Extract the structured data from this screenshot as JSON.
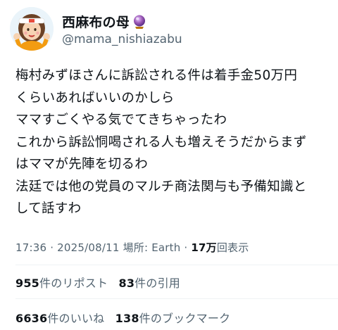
{
  "user": {
    "display_name": "西麻布の母",
    "handle": "@mama_nishiazabu",
    "badge_icon": "crystal-ball-icon",
    "avatar_icon": "avatar-illustration"
  },
  "tweet": {
    "lines": [
      "梅村みずほさんに訴訟される件は着手金50万円",
      "くらいあればいいのかしら",
      "ママすごくやる気でてきちゃったわ",
      "これから訴訟恫喝される人も増えそうだからまず",
      "はママが先陣を切るわ",
      "法廷では他の党員のマルチ商法関与も予備知識と",
      "して話すわ"
    ],
    "time": "17:36",
    "date": "2025/08/11",
    "location_label": "場所: Earth",
    "separator": "·",
    "views_count": "17万",
    "views_label": "回表示"
  },
  "stats": {
    "reposts_count": "955",
    "reposts_label": "件のリポスト",
    "quotes_count": "83",
    "quotes_label": "件の引用",
    "likes_count": "6636",
    "likes_label": "件のいいね",
    "bookmarks_count": "138",
    "bookmarks_label": "件のブックマーク"
  },
  "colors": {
    "text_primary": "#0f1419",
    "text_secondary": "#536471",
    "divider": "#eff3f4",
    "badge_purple": "#8e44ad"
  }
}
